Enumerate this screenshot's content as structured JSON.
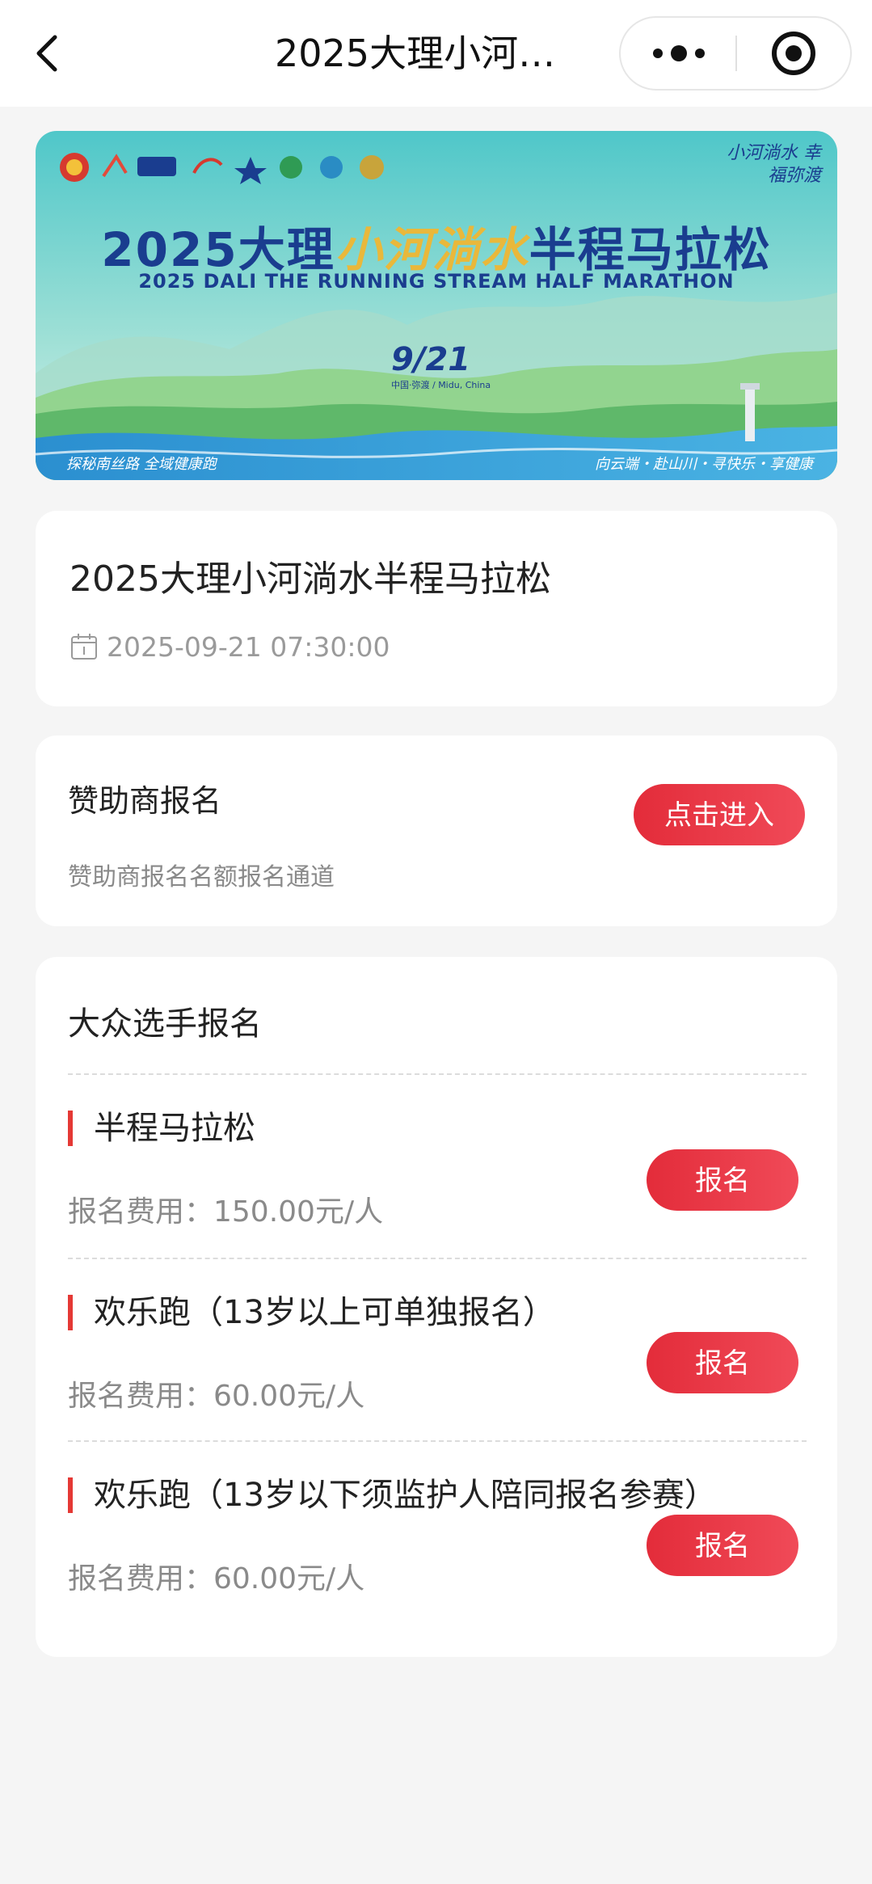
{
  "nav": {
    "title": "2025大理小河淌水半程马拉松",
    "title_display": "2025大理小河…"
  },
  "banner": {
    "title_prefix": "2025大理",
    "title_calligraphy": "小河淌水",
    "title_suffix": "半程马拉松",
    "subtitle": "2025 DALI THE RUNNING STREAM HALF MARATHON",
    "date": "9/21",
    "year_stack": "2025",
    "location": "中国·弥渡 / Midu, China",
    "slogan_top_right": "小河淌水 幸福弥渡",
    "slogan_bottom_left": "探秘南丝路  全域健康跑",
    "slogan_bottom_right": "向云端・赴山川・寻快乐・享健康",
    "colors": {
      "title": "#1a3d8f",
      "calligraphy": "#e9b83b"
    }
  },
  "event": {
    "title": "2025大理小河淌水半程马拉松",
    "datetime": "2025-09-21 07:30:00"
  },
  "sponsor": {
    "title": "赞助商报名",
    "description": "赞助商报名名额报名通道",
    "button_label": "点击进入"
  },
  "public": {
    "title": "大众选手报名",
    "races": [
      {
        "name": "半程马拉松",
        "fee": "报名费用：150.00元/人",
        "button_label": "报名"
      },
      {
        "name": "欢乐跑（13岁以上可单独报名）",
        "fee": "报名费用：60.00元/人",
        "button_label": "报名"
      },
      {
        "name": "欢乐跑（13岁以下须监护人陪同报名参赛）",
        "fee": "报名费用：60.00元/人",
        "button_label": "报名"
      }
    ]
  },
  "accent_color": "#e53935"
}
